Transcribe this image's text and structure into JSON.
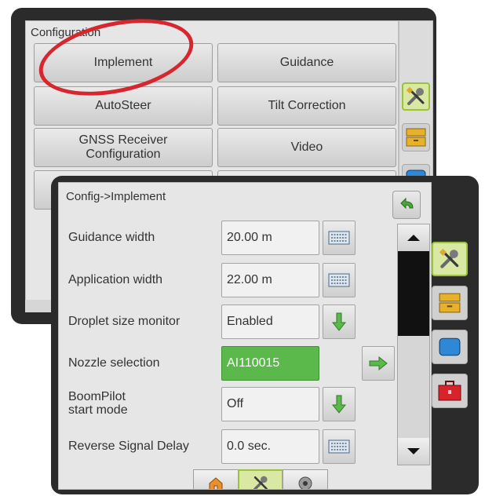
{
  "back_screen": {
    "title": "Configuration",
    "buttons": [
      {
        "label": "Implement"
      },
      {
        "label": "Guidance"
      },
      {
        "label": "AutoSteer"
      },
      {
        "label": "Tilt Correction"
      },
      {
        "label": "GNSS Receiver\nConfiguration"
      },
      {
        "label": "Video"
      }
    ],
    "icons": [
      "tools-icon",
      "cabinet-icon",
      "monitor-icon"
    ]
  },
  "front_screen": {
    "title": "Config->Implement",
    "rows": [
      {
        "label": "Guidance width",
        "value": "20.00 m",
        "control": "keyboard-icon"
      },
      {
        "label": "Application width",
        "value": "22.00 m",
        "control": "keyboard-icon"
      },
      {
        "label": "Droplet size monitor",
        "value": "Enabled",
        "control": "down-arrow-icon"
      },
      {
        "label": "Nozzle selection",
        "value": "AI110015",
        "control": "right-arrow-icon"
      },
      {
        "label": "BoomPilot\nstart mode",
        "value": "Off",
        "control": "down-arrow-icon"
      },
      {
        "label": "Reverse Signal Delay",
        "value": "0.0 sec.",
        "control": "keyboard-icon"
      }
    ],
    "side_icons": [
      "tools-icon",
      "cabinet-icon",
      "monitor-icon",
      "toolbox-icon"
    ],
    "tabs": [
      "home-icon",
      "tools-icon",
      "gauge-icon"
    ]
  },
  "colors": {
    "frame": "#2b2b2b",
    "panel": "#e6e6e6",
    "selected_value": "#5bb84a",
    "active_tab": "#d9e9a3",
    "annotation": "#d7262d"
  }
}
